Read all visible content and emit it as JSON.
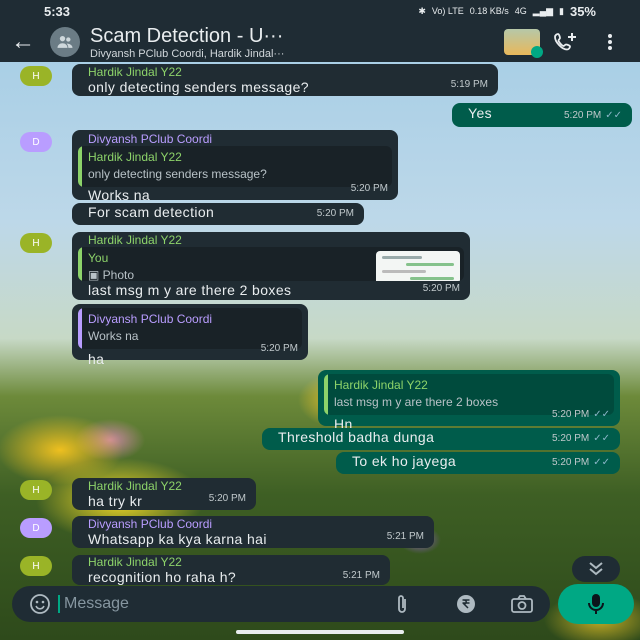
{
  "status_bar": {
    "time": "5:33",
    "network_icons": "Vo) LTE",
    "data_speed": "0.18 KB/s",
    "network_type": "4G",
    "battery": "35%"
  },
  "header": {
    "title": "Scam Detection - U···",
    "subtitle": "Divyansh PClub Coordi, Hardik Jindal···"
  },
  "messages": [
    {
      "dir": "in",
      "sender": "Hardik Jindal Y22",
      "text": "only detecting senders message?",
      "time": "5:19 PM"
    },
    {
      "dir": "out",
      "text": "Yes",
      "time": "5:20 PM"
    },
    {
      "dir": "in",
      "sender": "Divyansh PClub Coordi",
      "quote_name": "Hardik Jindal Y22",
      "quote_text": "only detecting senders message?",
      "text": "Works na",
      "time": "5:20 PM"
    },
    {
      "dir": "in",
      "text": "For scam detection",
      "time": "5:20 PM"
    },
    {
      "dir": "in",
      "sender": "Hardik Jindal Y22",
      "quote_name": "You",
      "quote_text": "Photo",
      "text": "last msg m y are there 2 boxes",
      "time": "5:20 PM"
    },
    {
      "dir": "in",
      "quote_name": "Divyansh PClub Coordi",
      "quote_text": "Works na",
      "text": "ha",
      "time": "5:20 PM"
    },
    {
      "dir": "out",
      "quote_name": "Hardik Jindal Y22",
      "quote_text": "last msg m y are there 2 boxes",
      "text": "Hn",
      "time": "5:20 PM"
    },
    {
      "dir": "out",
      "text": "Threshold badha dunga",
      "time": "5:20 PM"
    },
    {
      "dir": "out",
      "text": "To ek ho jayega",
      "time": "5:20 PM"
    },
    {
      "dir": "in",
      "sender": "Hardik Jindal Y22",
      "text": "ha try kr",
      "time": "5:20 PM"
    },
    {
      "dir": "in",
      "sender": "Divyansh PClub Coordi",
      "text": "Whatsapp ka kya karna hai",
      "time": "5:21 PM"
    },
    {
      "dir": "in",
      "sender": "Hardik Jindal Y22",
      "text": "recognition ho raha h?",
      "time": "5:21 PM"
    }
  ],
  "avatars": {
    "hardik": "H",
    "divyansh": "D"
  },
  "input": {
    "placeholder": "Message"
  },
  "colors": {
    "accent": "#00a884",
    "outgoing": "#005c4b",
    "incoming": "#202c33",
    "hardik": "#8dd36a",
    "divyansh": "#b99dff"
  },
  "icons": [
    "back-arrow-icon",
    "group-icon",
    "add-call-icon",
    "more-vert-icon",
    "emoji-icon",
    "attach-icon",
    "rupee-icon",
    "camera-icon",
    "mic-icon",
    "double-chevron-down-icon"
  ]
}
